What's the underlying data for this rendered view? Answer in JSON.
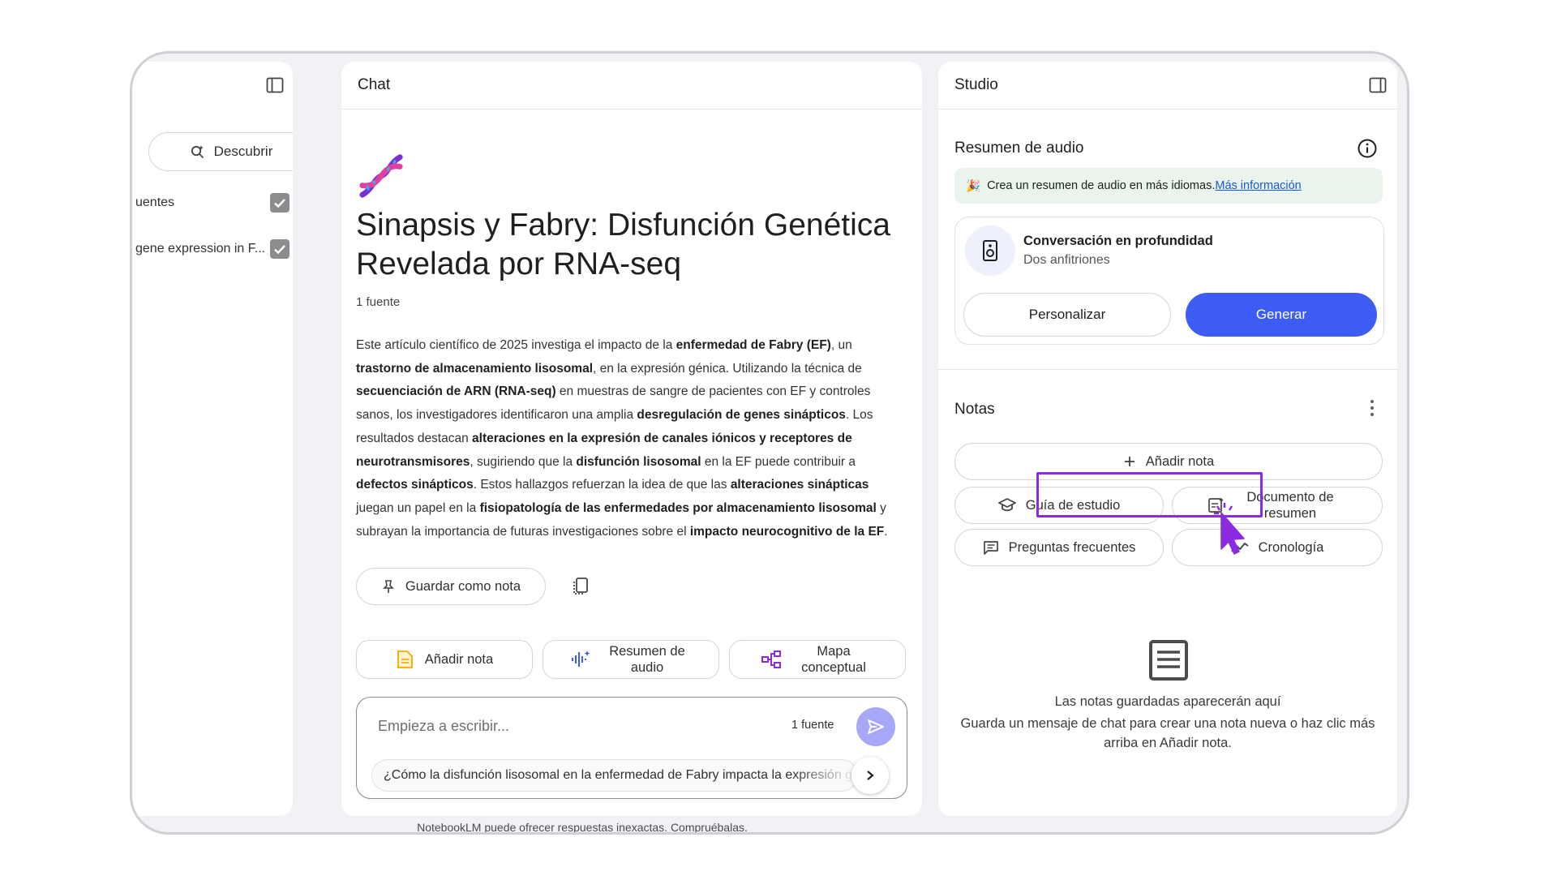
{
  "app": {
    "disclaimer": "NotebookLM puede ofrecer respuestas inexactas. Compruébalas."
  },
  "sources_panel": {
    "discover_label": "Descubrir",
    "items": [
      {
        "label": "uentes",
        "checked": true
      },
      {
        "label": "gene expression in F...",
        "checked": true
      }
    ]
  },
  "chat": {
    "header": "Chat",
    "icon": "dna-icon",
    "title": "Sinapsis y Fabry: Disfunción Genética Revelada por RNA-seq",
    "source_count": "1 fuente",
    "summary_segments": [
      {
        "t": "Este artículo científico de 2025 investiga el impacto de la ",
        "b": false
      },
      {
        "t": "enfermedad de Fabry (EF)",
        "b": true
      },
      {
        "t": ", un ",
        "b": false
      },
      {
        "t": "trastorno de almacenamiento lisosomal",
        "b": true
      },
      {
        "t": ", en la expresión génica. Utilizando la técnica de ",
        "b": false
      },
      {
        "t": "secuenciación de ARN (RNA-seq)",
        "b": true
      },
      {
        "t": " en muestras de sangre de pacientes con EF y controles sanos, los investigadores identificaron una amplia ",
        "b": false
      },
      {
        "t": "desregulación de genes sinápticos",
        "b": true
      },
      {
        "t": ". Los resultados destacan ",
        "b": false
      },
      {
        "t": "alteraciones en la expresión de canales iónicos y receptores de neurotransmisores",
        "b": true
      },
      {
        "t": ", sugiriendo que la ",
        "b": false
      },
      {
        "t": "disfunción lisosomal",
        "b": true
      },
      {
        "t": " en la EF puede contribuir a ",
        "b": false
      },
      {
        "t": "defectos sinápticos",
        "b": true
      },
      {
        "t": ". Estos hallazgos refuerzan la idea de que las ",
        "b": false
      },
      {
        "t": "alteraciones sinápticas",
        "b": true
      },
      {
        "t": " juegan un papel en la ",
        "b": false
      },
      {
        "t": "fisiopatología de las enfermedades por almacenamiento lisosomal",
        "b": true
      },
      {
        "t": " y subrayan la importancia de futuras investigaciones sobre el ",
        "b": false
      },
      {
        "t": "impacto neurocognitivo de la EF",
        "b": true
      },
      {
        "t": ".",
        "b": false
      }
    ],
    "save_note_label": "Guardar como nota",
    "actions": {
      "add_note": "Añadir nota",
      "audio_summary": "Resumen de audio",
      "concept_map": "Mapa conceptual"
    },
    "composer": {
      "placeholder": "Empieza a escribir...",
      "source_count": "1 fuente",
      "suggestion": "¿Cómo la disfunción lisosomal en la enfermedad de Fabry impacta la expresión génica sináptica?"
    }
  },
  "studio": {
    "header": "Studio",
    "audio_section_title": "Resumen de audio",
    "banner_text": "Crea un resumen de audio en más idiomas.",
    "banner_link": "Más información",
    "audio_card": {
      "title": "Conversación en profundidad",
      "subtitle": "Dos anfitriones",
      "personalize": "Personalizar",
      "generate": "Generar"
    },
    "notes_title": "Notas",
    "add_note": "Añadir nota",
    "quick_actions": {
      "study_guide": "Guía de estudio",
      "summary_doc": "Documento de resumen",
      "faq": "Preguntas frecuentes",
      "timeline": "Cronología"
    },
    "empty_title": "Las notas guardadas aparecerán aquí",
    "empty_desc": "Guarda un mensaje de chat para crear una nota nueva o haz clic más arriba en Añadir nota."
  },
  "colors": {
    "accent": "#3d5cf3",
    "highlight": "#8a2be2",
    "banner_bg": "#e9f5ec"
  }
}
